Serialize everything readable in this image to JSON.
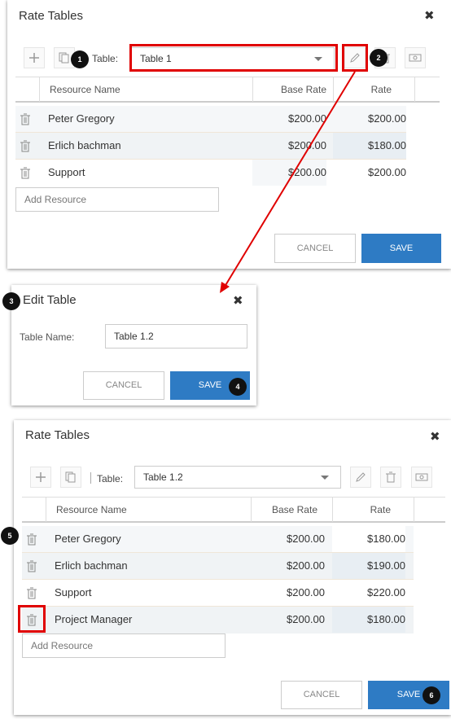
{
  "dialog1": {
    "title": "Rate Tables",
    "close": "✖",
    "table_label": "Table:",
    "table_value": "Table 1",
    "columns": [
      "Resource Name",
      "Base Rate",
      "Rate"
    ],
    "rows": [
      {
        "name": "Peter Gregory",
        "base": "$200.00",
        "rate": "$200.00"
      },
      {
        "name": "Erlich bachman",
        "base": "$200.00",
        "rate": "$180.00"
      },
      {
        "name": "Support",
        "base": "$200.00",
        "rate": "$200.00"
      }
    ],
    "add_placeholder": "Add Resource",
    "cancel": "CANCEL",
    "save": "SAVE"
  },
  "dialog2": {
    "title": "Edit Table",
    "close": "✖",
    "name_label": "Table Name:",
    "name_value": "Table 1.2",
    "cancel": "CANCEL",
    "save": "SAVE"
  },
  "dialog3": {
    "title": "Rate Tables",
    "close": "✖",
    "table_label": "Table:",
    "table_value": "Table 1.2",
    "columns": [
      "Resource Name",
      "Base Rate",
      "Rate"
    ],
    "rows": [
      {
        "name": "Peter Gregory",
        "base": "$200.00",
        "rate": "$180.00"
      },
      {
        "name": "Erlich bachman",
        "base": "$200.00",
        "rate": "$190.00"
      },
      {
        "name": "Support",
        "base": "$200.00",
        "rate": "$220.00"
      },
      {
        "name": "Project Manager",
        "base": "$200.00",
        "rate": "$180.00"
      }
    ],
    "add_placeholder": "Add Resource",
    "cancel": "CANCEL",
    "save": "SAVE"
  },
  "badges": [
    "1",
    "2",
    "3",
    "4",
    "5",
    "6"
  ],
  "icons": {
    "add": "plus-icon",
    "copy": "copy-icon",
    "edit": "pencil-icon",
    "delete": "trash-icon",
    "money": "money-icon",
    "close": "close-icon"
  },
  "colors": {
    "save_button": "#2e7bc4",
    "highlight": "#e00000",
    "row_alt": "#f0f3f5",
    "rate_bg": "#eef2f5"
  }
}
